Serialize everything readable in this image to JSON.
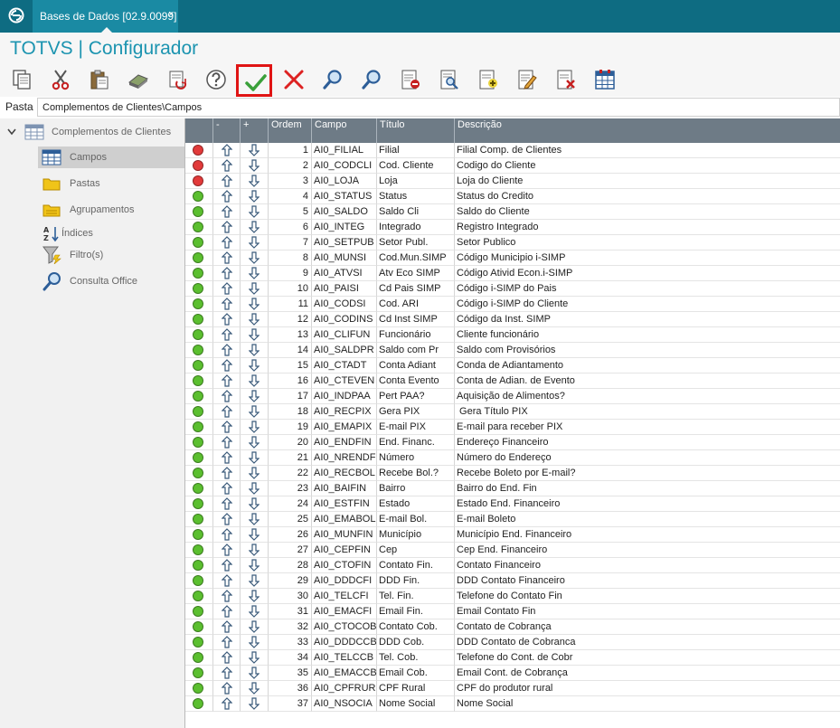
{
  "window": {
    "tab_label": "Bases de Dados [02.9.0099]",
    "tab_close": "×",
    "app_title": "TOTVS | Configurador"
  },
  "pasta": {
    "label": "Pasta",
    "value": "Complementos de Clientes\\Campos"
  },
  "tree": {
    "root_label": "Complementos de Clientes",
    "items": [
      {
        "label": "Campos",
        "selected": true
      },
      {
        "label": "Pastas",
        "selected": false
      },
      {
        "label": "Agrupamentos",
        "selected": false
      },
      {
        "label": "Índices",
        "selected": false
      },
      {
        "label": "Filtro(s)",
        "selected": false
      },
      {
        "label": "Consulta Office",
        "selected": false
      }
    ]
  },
  "grid": {
    "columns": [
      "",
      "-",
      "+",
      "Ordem",
      "Campo",
      "Título",
      "Descrição"
    ],
    "status_colors": {
      "red": "#e23a3a",
      "green": "#5bbf2f"
    },
    "rows": [
      {
        "status": "red",
        "ordem": "1",
        "campo": "AI0_FILIAL",
        "titulo": "Filial",
        "descricao": "Filial Comp. de Clientes"
      },
      {
        "status": "red",
        "ordem": "2",
        "campo": "AI0_CODCLI",
        "titulo": "Cod. Cliente",
        "descricao": "Codigo do Cliente"
      },
      {
        "status": "red",
        "ordem": "3",
        "campo": "AI0_LOJA",
        "titulo": "Loja",
        "descricao": "Loja do Cliente"
      },
      {
        "status": "green",
        "ordem": "4",
        "campo": "AI0_STATUS",
        "titulo": "Status",
        "descricao": "Status do Credito"
      },
      {
        "status": "green",
        "ordem": "5",
        "campo": "AI0_SALDO",
        "titulo": "Saldo Cli",
        "descricao": "Saldo do Cliente"
      },
      {
        "status": "green",
        "ordem": "6",
        "campo": "AI0_INTEG",
        "titulo": "Integrado",
        "descricao": "Registro Integrado"
      },
      {
        "status": "green",
        "ordem": "7",
        "campo": "AI0_SETPUB",
        "titulo": "Setor Publ.",
        "descricao": "Setor Publico"
      },
      {
        "status": "green",
        "ordem": "8",
        "campo": "AI0_MUNSI",
        "titulo": "Cod.Mun.SIMP",
        "descricao": "Código Municipio i-SIMP"
      },
      {
        "status": "green",
        "ordem": "9",
        "campo": "AI0_ATVSI",
        "titulo": "Atv Eco SIMP",
        "descricao": "Código Ativid Econ.i-SIMP"
      },
      {
        "status": "green",
        "ordem": "10",
        "campo": "AI0_PAISI",
        "titulo": "Cd Pais SIMP",
        "descricao": "Código i-SIMP do Pais"
      },
      {
        "status": "green",
        "ordem": "11",
        "campo": "AI0_CODSI",
        "titulo": "Cod. ARI",
        "descricao": "Código i-SIMP do Cliente"
      },
      {
        "status": "green",
        "ordem": "12",
        "campo": "AI0_CODINS",
        "titulo": "Cd Inst SIMP",
        "descricao": "Código da Inst. SIMP"
      },
      {
        "status": "green",
        "ordem": "13",
        "campo": "AI0_CLIFUN",
        "titulo": "Funcionário",
        "descricao": "Cliente funcionário"
      },
      {
        "status": "green",
        "ordem": "14",
        "campo": "AI0_SALDPR",
        "titulo": "Saldo com Pr",
        "descricao": "Saldo com Provisórios"
      },
      {
        "status": "green",
        "ordem": "15",
        "campo": "AI0_CTADT",
        "titulo": "Conta Adiant",
        "descricao": "Conda de Adiantamento"
      },
      {
        "status": "green",
        "ordem": "16",
        "campo": "AI0_CTEVEN",
        "titulo": "Conta Evento",
        "descricao": "Conta de Adian. de Evento"
      },
      {
        "status": "green",
        "ordem": "17",
        "campo": "AI0_INDPAA",
        "titulo": "Pert PAA?",
        "descricao": "Aquisição de Alimentos?"
      },
      {
        "status": "green",
        "ordem": "18",
        "campo": "AI0_RECPIX",
        "titulo": "Gera PIX",
        "descricao": " Gera Título PIX"
      },
      {
        "status": "green",
        "ordem": "19",
        "campo": "AI0_EMAPIX",
        "titulo": "E-mail PIX",
        "descricao": "E-mail para receber PIX"
      },
      {
        "status": "green",
        "ordem": "20",
        "campo": "AI0_ENDFIN",
        "titulo": "End. Financ.",
        "descricao": "Endereço Financeiro"
      },
      {
        "status": "green",
        "ordem": "21",
        "campo": "AI0_NRENDF",
        "titulo": "Número",
        "descricao": "Número do Endereço"
      },
      {
        "status": "green",
        "ordem": "22",
        "campo": "AI0_RECBOL",
        "titulo": "Recebe Bol.?",
        "descricao": "Recebe Boleto por E-mail?"
      },
      {
        "status": "green",
        "ordem": "23",
        "campo": "AI0_BAIFIN",
        "titulo": "Bairro",
        "descricao": "Bairro do End. Fin"
      },
      {
        "status": "green",
        "ordem": "24",
        "campo": "AI0_ESTFIN",
        "titulo": "Estado",
        "descricao": "Estado End. Financeiro"
      },
      {
        "status": "green",
        "ordem": "25",
        "campo": "AI0_EMABOL",
        "titulo": "E-mail Bol.",
        "descricao": "E-mail Boleto"
      },
      {
        "status": "green",
        "ordem": "26",
        "campo": "AI0_MUNFIN",
        "titulo": "Município",
        "descricao": "Município End. Financeiro"
      },
      {
        "status": "green",
        "ordem": "27",
        "campo": "AI0_CEPFIN",
        "titulo": "Cep",
        "descricao": "Cep End. Financeiro"
      },
      {
        "status": "green",
        "ordem": "28",
        "campo": "AI0_CTOFIN",
        "titulo": "Contato Fin.",
        "descricao": "Contato Financeiro"
      },
      {
        "status": "green",
        "ordem": "29",
        "campo": "AI0_DDDCFI",
        "titulo": "DDD Fin.",
        "descricao": "DDD Contato Financeiro"
      },
      {
        "status": "green",
        "ordem": "30",
        "campo": "AI0_TELCFI",
        "titulo": "Tel. Fin.",
        "descricao": "Telefone do Contato Fin"
      },
      {
        "status": "green",
        "ordem": "31",
        "campo": "AI0_EMACFI",
        "titulo": "Email Fin.",
        "descricao": "Email Contato Fin"
      },
      {
        "status": "green",
        "ordem": "32",
        "campo": "AI0_CTOCOB",
        "titulo": "Contato Cob.",
        "descricao": "Contato de Cobrança"
      },
      {
        "status": "green",
        "ordem": "33",
        "campo": "AI0_DDDCCB",
        "titulo": "DDD Cob.",
        "descricao": "DDD Contato de Cobranca"
      },
      {
        "status": "green",
        "ordem": "34",
        "campo": "AI0_TELCCB",
        "titulo": "Tel. Cob.",
        "descricao": "Telefone do Cont. de Cobr"
      },
      {
        "status": "green",
        "ordem": "35",
        "campo": "AI0_EMACCB",
        "titulo": "Email Cob.",
        "descricao": "Email Cont. de Cobrança"
      },
      {
        "status": "green",
        "ordem": "36",
        "campo": "AI0_CPFRUR",
        "titulo": "CPF Rural",
        "descricao": "CPF do produtor rural"
      },
      {
        "status": "green",
        "ordem": "37",
        "campo": "AI0_NSOCIA",
        "titulo": "Nome Social",
        "descricao": "Nome Social"
      }
    ]
  },
  "toolbar_icons": [
    "copy-icon",
    "cut-icon",
    "paste-icon",
    "eraser-icon",
    "refresh-icon",
    "help-icon",
    "confirm-check-icon",
    "cancel-x-icon",
    "search-icon",
    "search-next-icon",
    "document-remove-icon",
    "document-preview-icon",
    "document-add-icon",
    "edit-document-icon",
    "delete-document-icon",
    "table-icon"
  ]
}
